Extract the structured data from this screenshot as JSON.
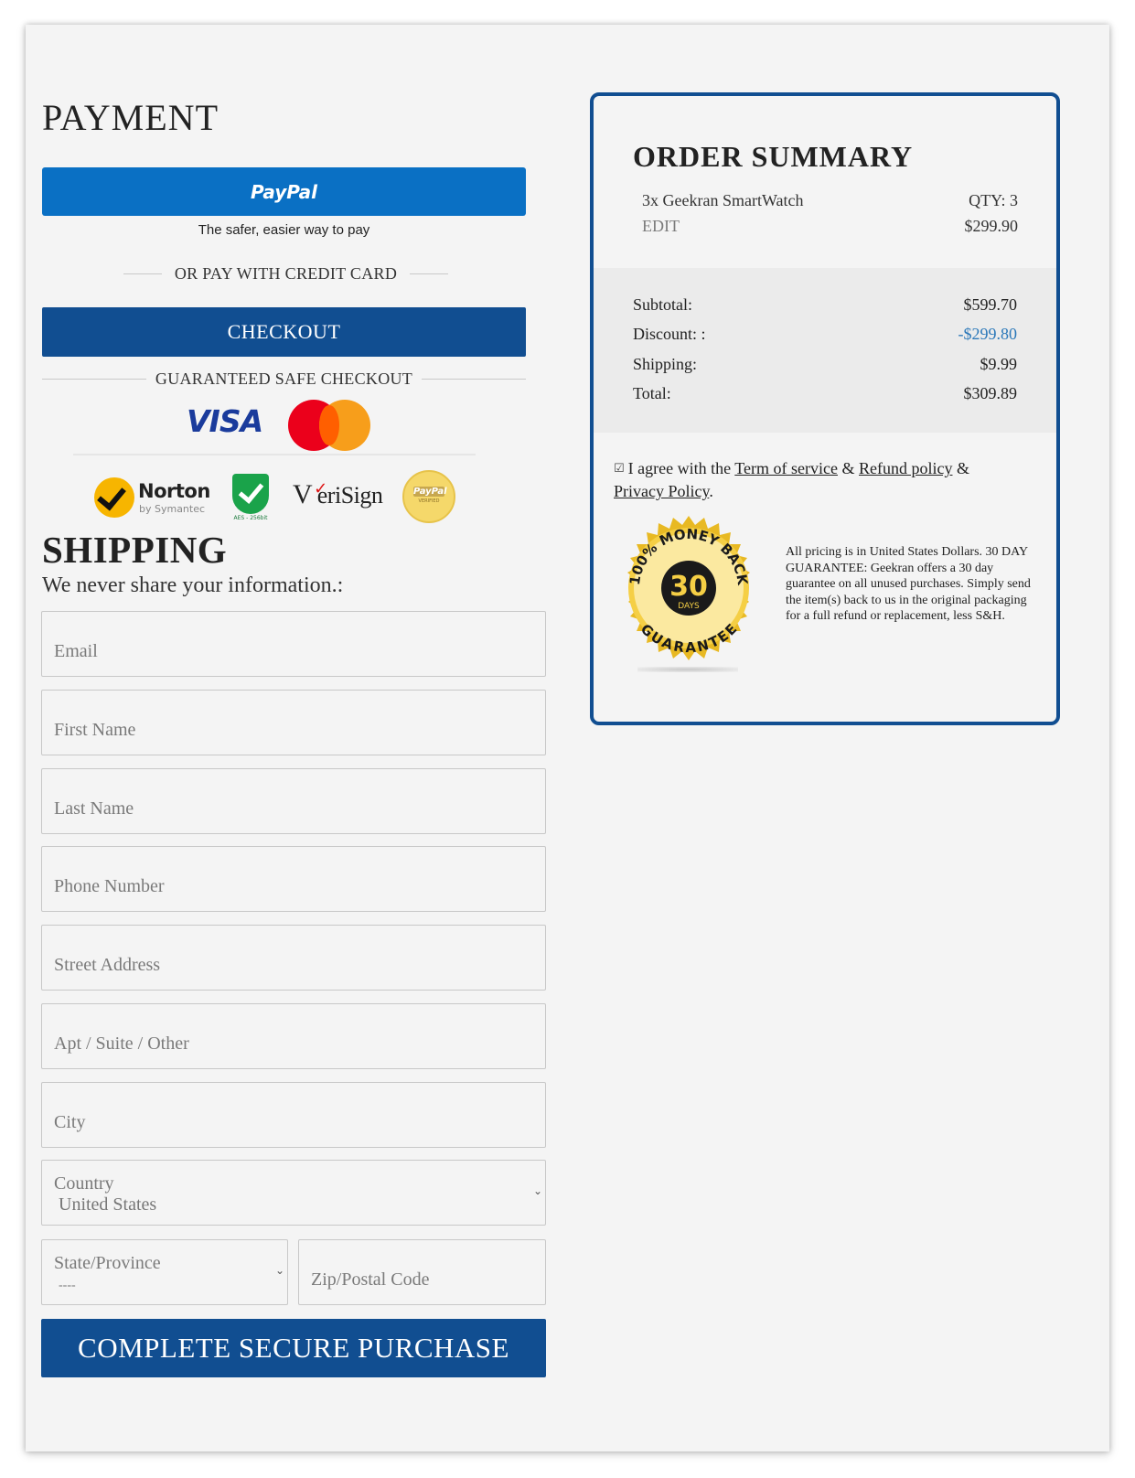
{
  "payment": {
    "title": "PAYMENT",
    "paypal_label": "PayPal",
    "paypal_tagline": "The safer, easier way to pay",
    "or_text": "OR PAY WITH CREDIT CARD",
    "checkout_label": "CHECKOUT",
    "guaranteed_text": "GUARANTEED SAFE CHECKOUT",
    "visa_text": "VISA",
    "norton_text": "Norton",
    "norton_sub": "by Symantec",
    "shield_text": "AES - 256bit",
    "verisign_check": "✓",
    "verisign_text": "eriSign",
    "paypal_seal_text": "PayPal",
    "paypal_seal_sub": "VERIFIED"
  },
  "shipping": {
    "title": "SHIPPING",
    "subtitle": "We never share your information.:",
    "fields": {
      "email": "Email",
      "first_name": "First Name",
      "last_name": "Last Name",
      "phone": "Phone Number",
      "street": "Street Address",
      "apt": "Apt / Suite / Other",
      "city": "City",
      "country_label": "Country",
      "country_value": "United States",
      "state_label": "State/Province",
      "state_value": "----",
      "zip": "Zip/Postal Code"
    },
    "chevron": "⌄",
    "purchase_label": "COMPLETE SECURE PURCHASE"
  },
  "summary": {
    "title": "ORDER SUMMARY",
    "item_name": "3x Geekran SmartWatch",
    "item_qty": "QTY: 3",
    "item_edit": "EDIT",
    "item_price": "$299.90",
    "subtotal_label": "Subtotal:",
    "subtotal_value": "$599.70",
    "discount_label": "Discount: :",
    "discount_value": "-$299.80",
    "shipping_label": "Shipping:",
    "shipping_value": "$9.99",
    "total_label": "Total:",
    "total_value": "$309.89",
    "agree_checkbox": "☑",
    "agree_prefix": "I agree with the",
    "terms_link": "Term of service",
    "amp1": "&",
    "refund_link": "Refund policy",
    "amp2": "&",
    "privacy_link": "Privacy Policy",
    "period": ".",
    "badge": {
      "top_text": "100% MONEY BACK",
      "number": "30",
      "days": "DAYS",
      "bottom_text": "GUARANTEE"
    },
    "guarantee_text": "All pricing is in United States Dollars. 30 DAY GUARANTEE: Geekran offers a 30 day guarantee on all unused purchases. Simply send the item(s) back to us in the original packaging for a full refund or replacement, less S&H."
  },
  "colors": {
    "paypal_blue": "#0a70c4",
    "primary_navy": "#114e91",
    "discount_blue": "#2b78b9",
    "badge_gold": "#e8b923"
  }
}
